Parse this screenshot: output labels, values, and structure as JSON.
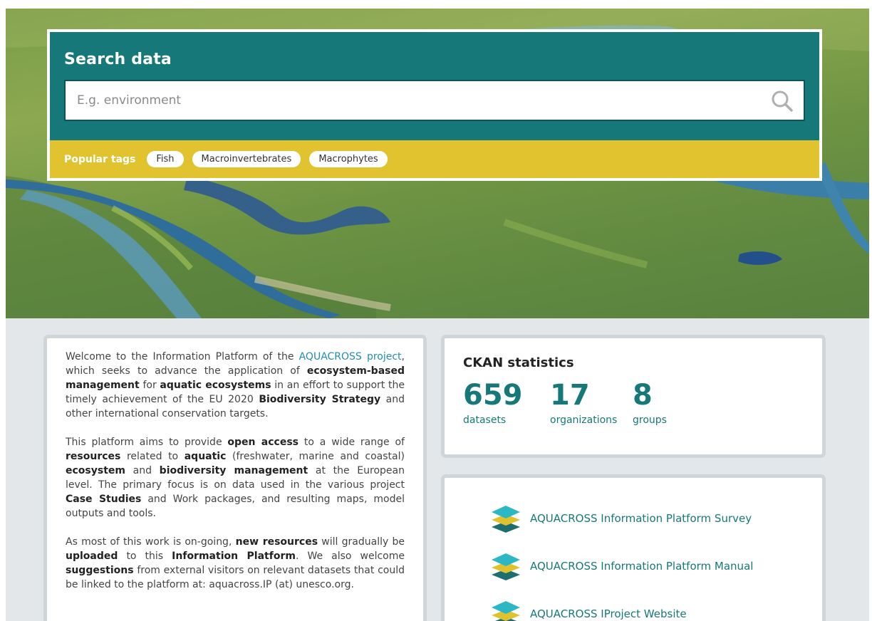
{
  "search": {
    "title": "Search data",
    "placeholder": "E.g. environment",
    "popular_tags_label": "Popular tags",
    "tags": [
      "Fish",
      "Macroinvertebrates",
      "Macrophytes"
    ]
  },
  "welcome": {
    "p1": [
      {
        "t": "Welcome to the Information Platform of the "
      },
      {
        "t": "AQUACROSS project",
        "link": true
      },
      {
        "t": ", which seeks to advance the application of "
      },
      {
        "t": "ecosystem-based management",
        "b": true
      },
      {
        "t": " for "
      },
      {
        "t": "aquatic ecosystems",
        "b": true
      },
      {
        "t": " in an effort to support the timely achievement of the EU 2020 "
      },
      {
        "t": "Biodiversity Strategy",
        "b": true
      },
      {
        "t": " and other international conservation targets."
      }
    ],
    "p2": [
      {
        "t": "This platform aims to provide "
      },
      {
        "t": "open access",
        "b": true
      },
      {
        "t": " to a wide range of "
      },
      {
        "t": "resources",
        "b": true
      },
      {
        "t": " related to "
      },
      {
        "t": "aquatic",
        "b": true
      },
      {
        "t": " (freshwater, marine and coastal) "
      },
      {
        "t": "ecosystem",
        "b": true
      },
      {
        "t": " and "
      },
      {
        "t": "biodiversity management",
        "b": true
      },
      {
        "t": " at the European level. The primary focus is on data used in the various project "
      },
      {
        "t": "Case Studies",
        "b": true
      },
      {
        "t": " and Work packages, and resulting maps, model outputs and tools."
      }
    ],
    "p3": [
      {
        "t": "As most of this work is on-going, "
      },
      {
        "t": "new resources",
        "b": true
      },
      {
        "t": " will gradually be "
      },
      {
        "t": "uploaded",
        "b": true
      },
      {
        "t": " to this "
      },
      {
        "t": "Information Platform",
        "b": true
      },
      {
        "t": ". We also welcome "
      },
      {
        "t": "suggestions",
        "b": true
      },
      {
        "t": " from external visitors on relevant datasets that could be linked to the platform at: aquacross.IP (at) unesco.org."
      }
    ]
  },
  "stats": {
    "title": "CKAN statistics",
    "items": [
      {
        "value": "659",
        "label": "datasets"
      },
      {
        "value": "17",
        "label": "organizations"
      },
      {
        "value": "8",
        "label": "groups"
      }
    ]
  },
  "links": [
    {
      "label": "AQUACROSS Information Platform Survey",
      "icon": "layers-icon"
    },
    {
      "label": "AQUACROSS Information Platform Manual",
      "icon": "layers-icon"
    },
    {
      "label": "AQUACROSS IProject Website",
      "icon": "layers-icon"
    }
  ],
  "colors": {
    "teal": "#17787a",
    "yellow": "#e1c22f",
    "link_blue": "#1f8fb5",
    "background": "#e3e7e9"
  }
}
